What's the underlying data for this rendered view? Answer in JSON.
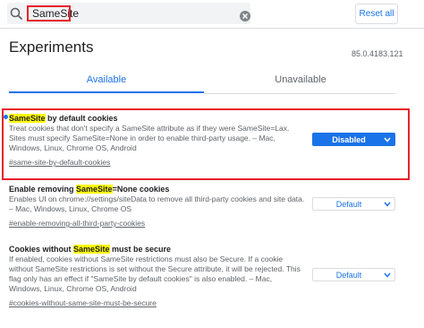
{
  "header": {
    "search_value": "SameSite",
    "reset_label": "Reset all"
  },
  "page": {
    "title": "Experiments",
    "version": "85.0.4183.121"
  },
  "tabs": [
    {
      "label": "Available",
      "selected": true
    },
    {
      "label": "Unavailable",
      "selected": false
    }
  ],
  "experiments": [
    {
      "title_pre": "",
      "title_match": "SameSite",
      "title_post": " by default cookies",
      "description": "Treat cookies that don't specify a SameSite attribute as if they were SameSite=Lax. Sites must specify SameSite=None in order to enable third-party usage. – Mac, Windows, Linux, Chrome OS, Android",
      "link": "#same-site-by-default-cookies",
      "value": "Disabled",
      "modified": true
    },
    {
      "title_pre": "Enable removing ",
      "title_match": "SameSite",
      "title_post": "=None cookies",
      "description": "Enables UI on chrome://settings/siteData to remove all third-party cookies and site data. – Mac, Windows, Linux, Chrome OS",
      "link": "#enable-removing-all-third-party-cookies",
      "value": "Default",
      "modified": false
    },
    {
      "title_pre": "Cookies without ",
      "title_match": "SameSite",
      "title_post": " must be secure",
      "description": "If enabled, cookies without SameSite restrictions must also be Secure. If a cookie without SameSite restrictions is set without the Secure attribute, it will be rejected. This flag only has an effect if \"SameSite by default cookies\" is also enabled. – Mac, Windows, Linux, Chrome OS, Android",
      "link": "#cookies-without-same-site-must-be-secure",
      "value": "Default",
      "modified": false
    }
  ],
  "colors": {
    "accent": "#1a73e8",
    "annotation_box": "#e5222b",
    "search_highlight": "#fffb00"
  }
}
